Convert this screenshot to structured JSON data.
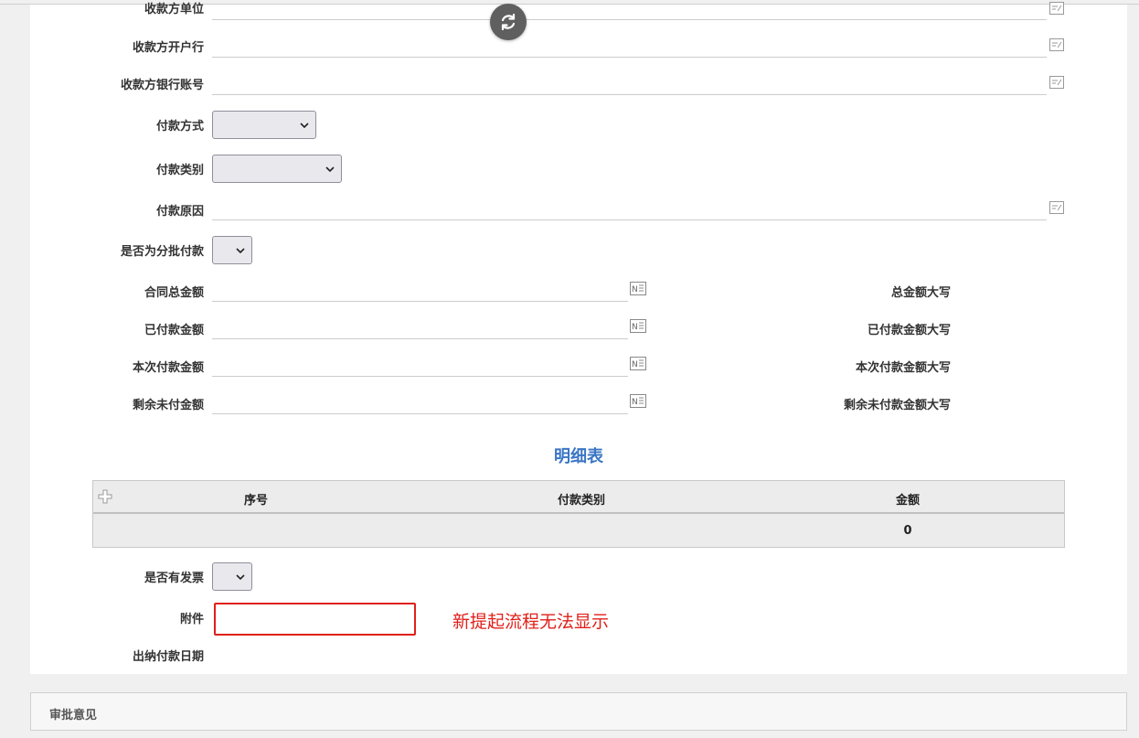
{
  "form": {
    "payee_unit_label": "收款方单位",
    "payee_bank_label": "收款方开户行",
    "payee_account_label": "收款方银行账号",
    "payment_method_label": "付款方式",
    "payment_category_label": "付款类别",
    "payment_reason_label": "付款原因",
    "is_batch_label": "是否为分批付款",
    "contract_total_label": "合同总金额",
    "paid_amount_label": "已付款金额",
    "current_payment_label": "本次付款金额",
    "remaining_label": "剩余未付金额",
    "total_upper_label": "总金额大写",
    "paid_upper_label": "已付款金额大写",
    "current_upper_label": "本次付款金额大写",
    "remaining_upper_label": "剩余未付款金额大写",
    "has_invoice_label": "是否有发票",
    "attachment_label": "附件",
    "cashier_date_label": "出纳付款日期"
  },
  "detail_table": {
    "title": "明细表",
    "columns": [
      "序号",
      "付款类别",
      "金额"
    ],
    "total_amount": "0"
  },
  "annotation": {
    "note": "新提起流程无法显示",
    "color": "#e0201a"
  },
  "approval": {
    "title": "审批意见"
  },
  "icons": {
    "refresh": "refresh-icon",
    "edit": "edit-icon",
    "number": "number-format-icon",
    "add": "add-row-icon"
  }
}
